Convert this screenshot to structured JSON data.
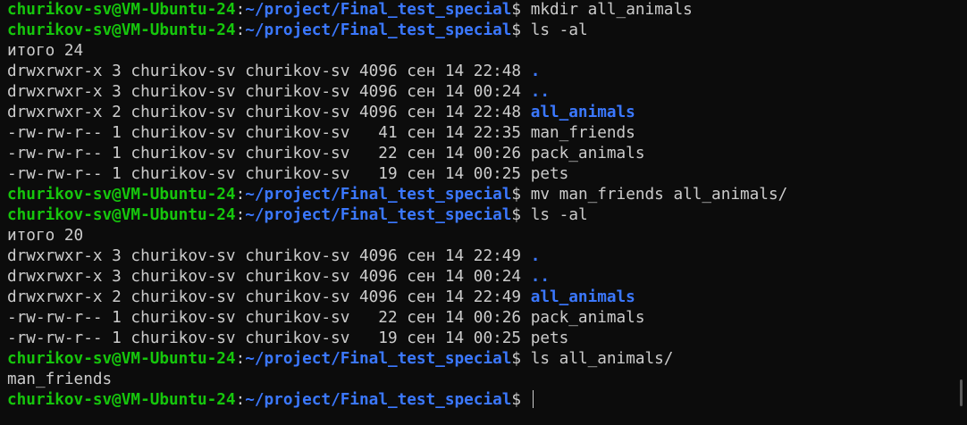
{
  "prompt": {
    "user_host": "churikov-sv@VM-Ubuntu-24",
    "sep": ":",
    "path": "~/project/Final_test_special",
    "dollar": "$ "
  },
  "commands": {
    "c1": "mkdir all_animals",
    "c2": "ls -al",
    "c3": "mv man_friends all_animals/",
    "c4": "ls -al",
    "c5": "ls all_animals/",
    "c6": ""
  },
  "listing1": {
    "total": "итого 24",
    "rows": [
      {
        "meta": "drwxrwxr-x 3 churikov-sv churikov-sv 4096 сен 14 22:48 ",
        "name": ".",
        "is_dir": true
      },
      {
        "meta": "drwxrwxr-x 3 churikov-sv churikov-sv 4096 сен 14 00:24 ",
        "name": "..",
        "is_dir": true
      },
      {
        "meta": "drwxrwxr-x 2 churikov-sv churikov-sv 4096 сен 14 22:48 ",
        "name": "all_animals",
        "is_dir": true
      },
      {
        "meta": "-rw-rw-r-- 1 churikov-sv churikov-sv   41 сен 14 22:35 ",
        "name": "man_friends",
        "is_dir": false
      },
      {
        "meta": "-rw-rw-r-- 1 churikov-sv churikov-sv   22 сен 14 00:26 ",
        "name": "pack_animals",
        "is_dir": false
      },
      {
        "meta": "-rw-rw-r-- 1 churikov-sv churikov-sv   19 сен 14 00:25 ",
        "name": "pets",
        "is_dir": false
      }
    ]
  },
  "listing2": {
    "total": "итого 20",
    "rows": [
      {
        "meta": "drwxrwxr-x 3 churikov-sv churikov-sv 4096 сен 14 22:49 ",
        "name": ".",
        "is_dir": true
      },
      {
        "meta": "drwxrwxr-x 3 churikov-sv churikov-sv 4096 сен 14 00:24 ",
        "name": "..",
        "is_dir": true
      },
      {
        "meta": "drwxrwxr-x 2 churikov-sv churikov-sv 4096 сен 14 22:49 ",
        "name": "all_animals",
        "is_dir": true
      },
      {
        "meta": "-rw-rw-r-- 1 churikov-sv churikov-sv   22 сен 14 00:26 ",
        "name": "pack_animals",
        "is_dir": false
      },
      {
        "meta": "-rw-rw-r-- 1 churikov-sv churikov-sv   19 сен 14 00:25 ",
        "name": "pets",
        "is_dir": false
      }
    ]
  },
  "output_ls_all_animals": "man_friends",
  "colors": {
    "background": "#0c0c0c",
    "text": "#cccccc",
    "prompt_user": "#16c60c",
    "prompt_path": "#3b78ff",
    "directory": "#3b78ff"
  }
}
